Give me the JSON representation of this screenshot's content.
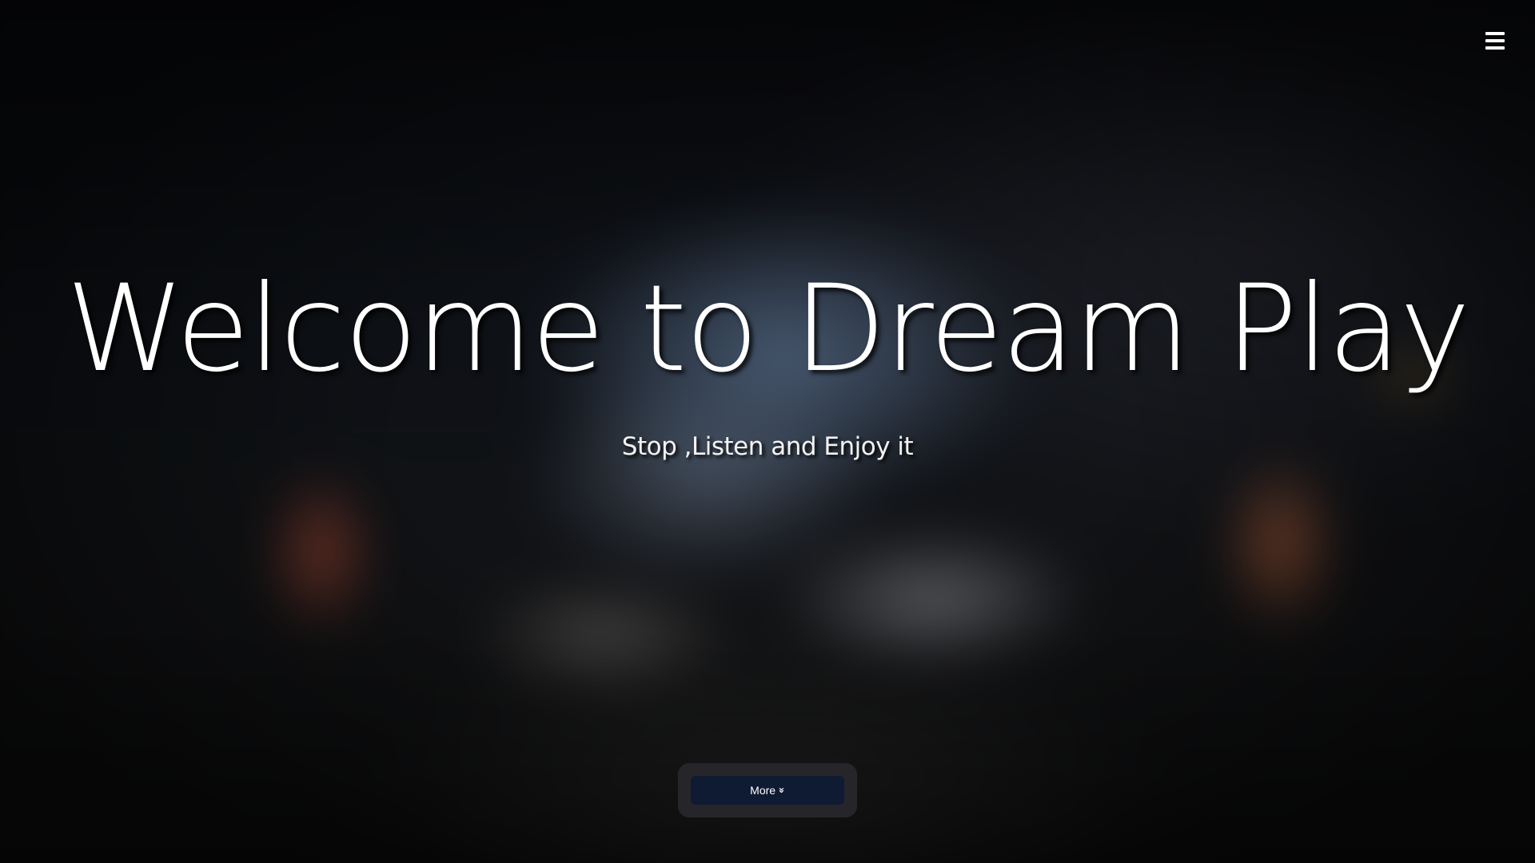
{
  "header": {
    "menu_icon": "hamburger-menu-icon"
  },
  "hero": {
    "title": "Welcome to Dream Play",
    "subtitle": "Stop ,Listen and Enjoy it",
    "more_label": "More",
    "more_icon": "double-chevron-down-icon",
    "more_icon_glyph": "»"
  },
  "colors": {
    "title_text": "#ffffff",
    "button_bg": "#0f1a33",
    "button_frame": "#28282c"
  }
}
